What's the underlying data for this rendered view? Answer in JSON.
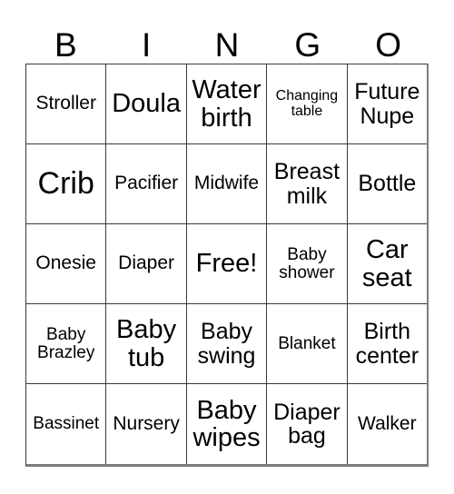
{
  "header": {
    "letters": [
      "B",
      "I",
      "N",
      "G",
      "O"
    ]
  },
  "grid": {
    "rows": [
      [
        {
          "text": "Stroller",
          "size": "sm"
        },
        {
          "text": "Doula",
          "size": "lg"
        },
        {
          "text": "Water\nbirth",
          "size": "lg"
        },
        {
          "text": "Changing\ntable",
          "size": "xxs"
        },
        {
          "text": "Future\nNupe",
          "size": "md"
        }
      ],
      [
        {
          "text": "Crib",
          "size": "xl"
        },
        {
          "text": "Pacifier",
          "size": "sm"
        },
        {
          "text": "Midwife",
          "size": "sm"
        },
        {
          "text": "Breast\nmilk",
          "size": "md"
        },
        {
          "text": "Bottle",
          "size": "md"
        }
      ],
      [
        {
          "text": "Onesie",
          "size": "sm"
        },
        {
          "text": "Diaper",
          "size": "sm"
        },
        {
          "text": "Free!",
          "size": "lg"
        },
        {
          "text": "Baby\nshower",
          "size": "xs"
        },
        {
          "text": "Car\nseat",
          "size": "lg"
        }
      ],
      [
        {
          "text": "Baby\nBrazley",
          "size": "xs"
        },
        {
          "text": "Baby\ntub",
          "size": "lg"
        },
        {
          "text": "Baby\nswing",
          "size": "md"
        },
        {
          "text": "Blanket",
          "size": "xs"
        },
        {
          "text": "Birth\ncenter",
          "size": "md"
        }
      ],
      [
        {
          "text": "Bassinet",
          "size": "xs"
        },
        {
          "text": "Nursery",
          "size": "sm"
        },
        {
          "text": "Baby\nwipes",
          "size": "lg"
        },
        {
          "text": "Diaper\nbag",
          "size": "md"
        },
        {
          "text": "Walker",
          "size": "sm"
        }
      ]
    ]
  }
}
